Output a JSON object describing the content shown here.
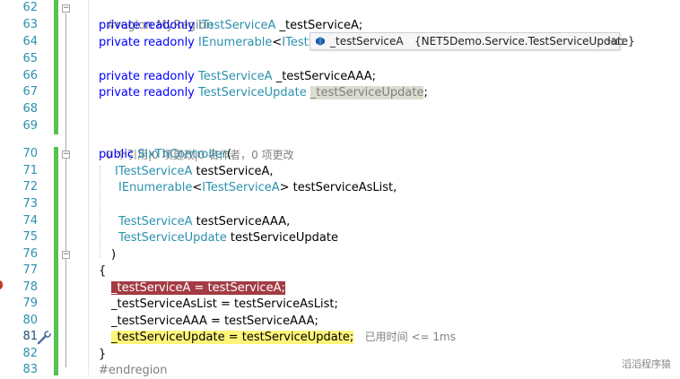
{
  "line_numbers": [
    "62",
    "63",
    "64",
    "65",
    "66",
    "67",
    "68",
    "69",
    "70",
    "71",
    "72",
    "73",
    "74",
    "75",
    "76",
    "77",
    "78",
    "79",
    "80",
    "81",
    "82",
    "83"
  ],
  "code": {
    "l62": "#region MyRegion",
    "l63_kw": "private readonly ",
    "l63_type": "ITestServiceA",
    "l63_field": " _testServiceA;",
    "l64_kw": "private readonly ",
    "l64_type": "IEnumerable",
    "l64_lt": "<",
    "l64_type2": "ITestServic",
    "l66_kw": "private readonly ",
    "l66_type": "TestServiceA",
    "l66_field": " _testServiceAAA;",
    "l67_kw": "private readonly ",
    "l67_type": "TestServiceUpdate",
    "l67_sp": " ",
    "l67_field": "_testServiceUpdate",
    "l67_semi": ";",
    "l69_lens": "0 个引用|0 项更改|0 名作者，0 项更改",
    "l70_kw": "public ",
    "l70_name": "SixThController",
    "l70_paren": "(",
    "l71_type": "ITestServiceA",
    "l71_param": " testServiceA,",
    "l72_type": "IEnumerable",
    "l72_lt": "<",
    "l72_type2": "ITestServiceA",
    "l72_rest": "> testServiceAsList,",
    "l74_type": "TestServiceA",
    "l74_param": " testServiceAAA,",
    "l75_type": "TestServiceUpdate",
    "l75_param": " testServiceUpdate",
    "l76": ")",
    "l77": "{",
    "l78_stmt": "_testServiceA = testServiceA;",
    "l79": "_testServiceAsList = testServiceAsList;",
    "l80": "_testServiceAAA = testServiceAAA;",
    "l81_stmt": "_testServiceUpdate = testServiceUpdate;",
    "l81_hint": "已用时间 <= 1ms",
    "l82": "}",
    "l83": "#endregion"
  },
  "tooltip": {
    "name": "_testServiceA",
    "type": "{NET5Demo.Service.TestServiceUpdate}",
    "pin": "⊣⊏"
  },
  "watermark": "滔滔程序猿",
  "colors": {
    "keyword": "#0000ff",
    "type": "#2b91af",
    "line_number": "#2b91af",
    "breakpoint_highlight": "#a33b44",
    "current_statement": "#fff57a",
    "change_bar": "#55c34f"
  }
}
